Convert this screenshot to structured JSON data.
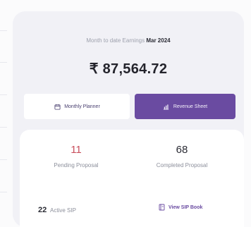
{
  "earnings": {
    "label": "Month to date Earnings",
    "month": "Mar 2024",
    "amount": "₹ 87,564.72"
  },
  "actions": {
    "planner_label": "Monthly Planner",
    "planner_icon": "calendar-icon",
    "revenue_label": "Revenue Sheet",
    "revenue_icon": "bar-chart-icon"
  },
  "stats": {
    "pending_count": "11",
    "pending_label": "Pending Proposal",
    "completed_count": "68",
    "completed_label": "Completed Proposal",
    "active_sip_count": "22",
    "active_sip_label": "Active SIP",
    "view_sip_label": "View SIP Book",
    "view_sip_icon": "book-icon"
  },
  "colors": {
    "accent": "#6a4ba1",
    "pending": "#c9505e",
    "card_bg": "#f1f1f6"
  }
}
